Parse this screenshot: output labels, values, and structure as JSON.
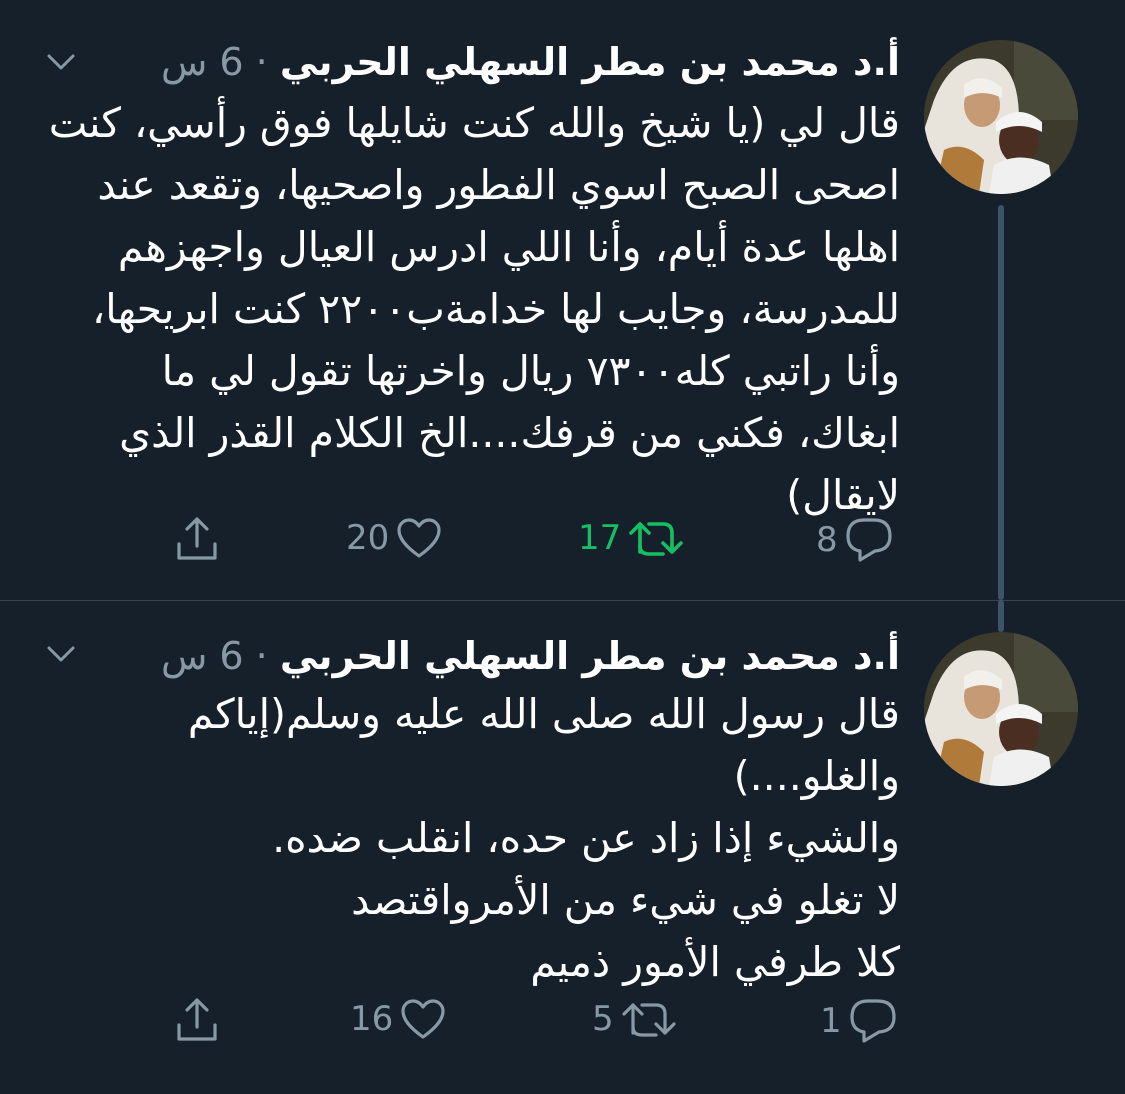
{
  "tweets": [
    {
      "author": "أ.د محمد بن مطر السهلي الحربي",
      "time": "· 6 س",
      "text": "قال لي (يا شيخ والله كنت شايلها فوق رأسي، كنت\nاصحى الصبح اسوي الفطور واصحيها، وتقعد عند\nاهلها عدة أيام، وأنا اللي ادرس العيال واجهزهم\nللمدرسة، وجايب لها خدامةب٢٢٠٠ كنت ابريحها،\nوأنا راتبي كله٧٣٠٠ ريال  واخرتها تقول لي ما\nابغاك، فكني من قرفك....الخ الكلام القذر الذي\nلايقال)",
      "replies": "8",
      "retweets": "17",
      "likes": "20",
      "retweeted": true
    },
    {
      "author": "أ.د محمد بن مطر السهلي الحربي",
      "time": "· 6 س",
      "text": "قال رسول الله صلى الله عليه وسلم(إياكم\nوالغلو....)\nوالشيء إذا زاد عن حده، انقلب ضده.\nلا تغلو في شيء من الأمرواقتصد\n                    كلا طرفي الأمور ذميم",
      "replies": "1",
      "retweets": "5",
      "likes": "16",
      "retweeted": false
    }
  ],
  "icons": [
    "chevron-down-icon",
    "reply-icon",
    "retweet-icon",
    "like-icon",
    "share-icon"
  ],
  "colors": {
    "background": "#15202b",
    "secondary": "#8899a6",
    "retweet_active": "#17bf63",
    "divider": "#38444d"
  }
}
